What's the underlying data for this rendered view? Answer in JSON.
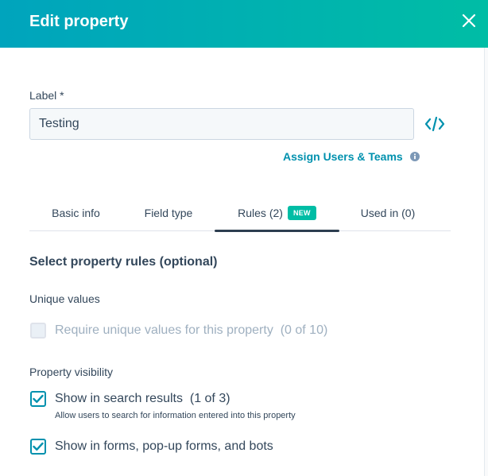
{
  "header": {
    "title": "Edit property"
  },
  "form": {
    "label_text": "Label *",
    "label_value": "Testing",
    "assign_link": "Assign Users & Teams"
  },
  "tabs": [
    {
      "label": "Basic info",
      "active": false
    },
    {
      "label": "Field type",
      "active": false
    },
    {
      "label": "Rules (2)",
      "active": true,
      "badge": "NEW"
    },
    {
      "label": "Used in (0)",
      "active": false
    }
  ],
  "rules": {
    "title": "Select property rules (optional)",
    "unique_values": {
      "label": "Unique values",
      "option": {
        "text": "Require unique values for this property",
        "count": "(0 of 10)",
        "checked": false,
        "disabled": true
      }
    },
    "visibility": {
      "label": "Property visibility",
      "options": [
        {
          "text": "Show in search results",
          "count": "(1 of 3)",
          "description": "Allow users to search for information entered into this property",
          "checked": true
        },
        {
          "text": "Show in forms, pop-up forms, and bots",
          "checked": true
        }
      ]
    }
  },
  "colors": {
    "header_start": "#00a4bd",
    "header_end": "#00bda5",
    "accent": "#0091ae",
    "badge": "#00bda5",
    "text": "#33475b"
  }
}
